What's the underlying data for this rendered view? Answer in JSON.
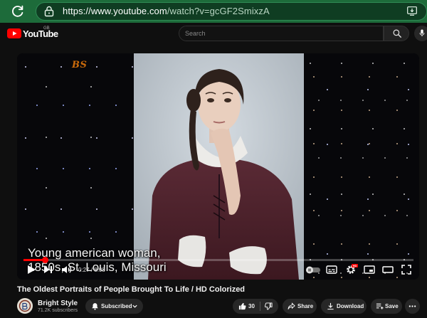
{
  "browser": {
    "url_host": "https://www.youtube.com",
    "url_path": "/watch?v=gcGF2SmixzA"
  },
  "header": {
    "logo_text": "YouTube",
    "region": "GB",
    "search_placeholder": "Search"
  },
  "player": {
    "watermark": "BS",
    "caption_line1": "Young american woman,",
    "caption_line2": "1850s, St. Louis, Missouri",
    "time": "0:27 / 8:08",
    "progress": 0.055,
    "settings_badge": "HD",
    "accent_color": "#ff0000"
  },
  "video": {
    "title": "The Oldest Portraits of People Brought To Life / HD Colorized"
  },
  "channel": {
    "name": "Bright Style",
    "subscribers": "71.2K subscribers",
    "subscribed_label": "Subscribed"
  },
  "actions": {
    "like_count": "30",
    "share_label": "Share",
    "download_label": "Download",
    "save_label": "Save"
  },
  "icons": [
    "reload-icon",
    "lock-icon",
    "install-app-icon",
    "youtube-logo-icon",
    "search-icon",
    "mic-icon",
    "play-icon",
    "next-icon",
    "volume-icon",
    "autoplay-toggle",
    "subtitles-icon",
    "settings-icon",
    "miniplayer-icon",
    "theater-icon",
    "fullscreen-icon",
    "bell-icon",
    "chevron-down-icon",
    "like-icon",
    "dislike-icon",
    "share-icon",
    "download-icon",
    "save-icon",
    "more-icon"
  ]
}
